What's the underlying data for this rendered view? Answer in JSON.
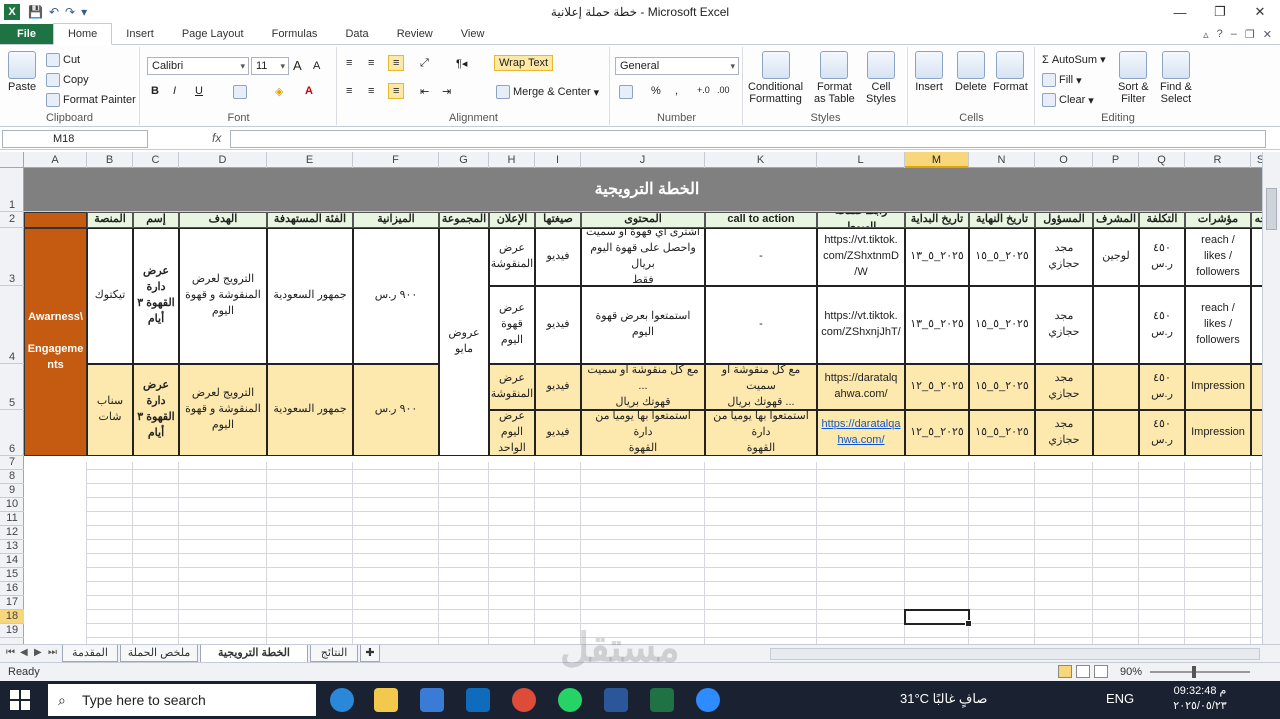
{
  "window": {
    "title": "خطة حملة إعلانية  -  Microsoft Excel",
    "controls": [
      "—",
      "❐",
      "✕"
    ]
  },
  "qat": {
    "save": "💾",
    "undo": "↶",
    "redo": "↷"
  },
  "tabs": [
    "File",
    "Home",
    "Insert",
    "Page Layout",
    "Formulas",
    "Data",
    "Review",
    "View"
  ],
  "ribbon": {
    "clipboard": {
      "label": "Clipboard",
      "paste": "Paste",
      "cut": "Cut",
      "copy": "Copy",
      "format_painter": "Format Painter"
    },
    "font": {
      "label": "Font",
      "name": "Calibri",
      "size": "11",
      "bold": "B",
      "italic": "I",
      "underline": "U"
    },
    "alignment": {
      "label": "Alignment",
      "wrap": "Wrap Text",
      "merge": "Merge & Center"
    },
    "number": {
      "label": "Number",
      "format": "General",
      "percent": "%",
      "comma": ","
    },
    "styles": {
      "label": "Styles",
      "cond": "Conditional\nFormatting",
      "table": "Format\nas Table",
      "cell": "Cell\nStyles"
    },
    "cells": {
      "label": "Cells",
      "insert": "Insert",
      "delete": "Delete",
      "format": "Format"
    },
    "editing": {
      "label": "Editing",
      "autosum": "AutoSum",
      "fill": "Fill",
      "clear": "Clear",
      "sort": "Sort &\nFilter",
      "find": "Find &\nSelect"
    }
  },
  "formula_bar": {
    "name_box": "M18",
    "fx": "fx",
    "value": ""
  },
  "columns": [
    "A",
    "B",
    "C",
    "D",
    "E",
    "F",
    "G",
    "H",
    "I",
    "J",
    "K",
    "L",
    "M",
    "N",
    "O",
    "P",
    "Q",
    "R",
    "S"
  ],
  "selected_column": "M",
  "rows": [
    "1",
    "2",
    "3",
    "4",
    "5",
    "6",
    "7",
    "8",
    "9",
    "10",
    "11",
    "12",
    "13",
    "14",
    "15",
    "16",
    "17",
    "18",
    "19"
  ],
  "selected_row": "18",
  "sheet": {
    "banner": "الخطة الترويجية",
    "headers": {
      "platform": "المنصة",
      "name": "إسم",
      "goal": "الهدف",
      "audience": "الفئة المستهدفة",
      "budget": "الميزانية",
      "group": "المجموعة",
      "ad": "الإعلان",
      "format": "صيغتها",
      "content": "المحتوى",
      "cta": "call to action",
      "landing": "رابط صفحة الهبوط",
      "start": "تاريخ البداية",
      "end": "تاريخ النهاية",
      "owner": "المسؤول",
      "supervisor": "المشرف",
      "cost": "التكلفة",
      "kpi": "مؤشرات",
      "extra": "جه"
    },
    "objective": "Awarness\\\n\nEngageme\nnts",
    "group_value": "عروض\nمايو",
    "blocks": [
      {
        "platform": "تيكتوك",
        "name": "عرض\nدارة\nالقهوة ٣\nأيام",
        "goal": "الترويج لعرض\nالمنقوشة و قهوة\nاليوم",
        "audience": "جمهور السعودية",
        "budget": "٩٠٠ ر.س"
      },
      {
        "platform": "سناب\nشات",
        "name": "عرض\nدارة\nالقهوة ٣\nأيام",
        "goal": "الترويج لعرض\nالمنقوشة و قهوة\nاليوم",
        "audience": "جمهور السعودية",
        "budget": "٩٠٠ ر.س"
      }
    ],
    "ads": [
      {
        "ad": "عرض\nالمنقوشة",
        "format": "فيديو",
        "content": "اشترى أي قهوة أو سميت\nواحصل على قهوة اليوم بريال\nفقط",
        "cta": "-",
        "landing": "https://vt.tiktok.\ncom/ZShxtnmD\n/W",
        "start": "٢٠٢٥_٥_١٣",
        "end": "٢٠٢٥_٥_١٥",
        "owner": "مجد\nحجازي",
        "supervisor": "لوجين",
        "cost": "٤٥٠ ر.س",
        "kpi": "reach /\nlikes /\nfollowers"
      },
      {
        "ad": "عرض\nقهوة اليوم",
        "format": "فيديو",
        "content": "استمتعوا بعرض قهوة اليوم",
        "cta": "-",
        "landing": "https://vt.tiktok.\ncom/ZShxnjJhT/",
        "start": "٢٠٢٥_٥_١٣",
        "end": "٢٠٢٥_٥_١٥",
        "owner": "مجد\nحجازي",
        "supervisor": "",
        "cost": "٤٥٠ ر.س",
        "kpi": "reach /\nlikes /\nfollowers"
      },
      {
        "ad": "عرض\nالمنقوشة",
        "format": "فيديو",
        "content": "مع كل منقوشة أو سميت ...\nقهوتك بريال",
        "cta": "مع كل منقوشة أو سميت\n... قهوتك بريال",
        "landing": "https://daratalq\nahwa.com/",
        "start": "٢٠٢٥_٥_١٢",
        "end": "٢٠٢٥_٥_١٥",
        "owner": "مجد\nحجازي",
        "supervisor": "",
        "cost": "٤٥٠ ر.س",
        "kpi": "Impression"
      },
      {
        "ad": "عرض\nاليوم\nالواحد",
        "format": "فيديو",
        "content": "استمتعوا بها يوميا من دارة\nالقهوة",
        "cta": "استمتعوا بها يوميا من دارة\nالقهوة",
        "landing": "https://daratalqa\nhwa.com/",
        "start": "٢٠٢٥_٥_١٢",
        "end": "٢٠٢٥_٥_١٥",
        "owner": "مجد\nحجازي",
        "supervisor": "",
        "cost": "٤٥٠ ر.س",
        "kpi": "Impression"
      }
    ]
  },
  "sheet_tabs": [
    "المقدمة",
    "ملخص الحملة",
    "الخطة الترويجية",
    "النتائج"
  ],
  "active_sheet": "الخطة الترويجية",
  "status": {
    "ready": "Ready",
    "zoom": "90%"
  },
  "taskbar": {
    "search_placeholder": "Type here to search",
    "weather": "31°C  صافٍ غالبًا",
    "lang": "ENG",
    "time": "09:32:48 م",
    "date": "٢٠٢٥/٠٥/٢٣"
  },
  "watermark": "مستقل"
}
